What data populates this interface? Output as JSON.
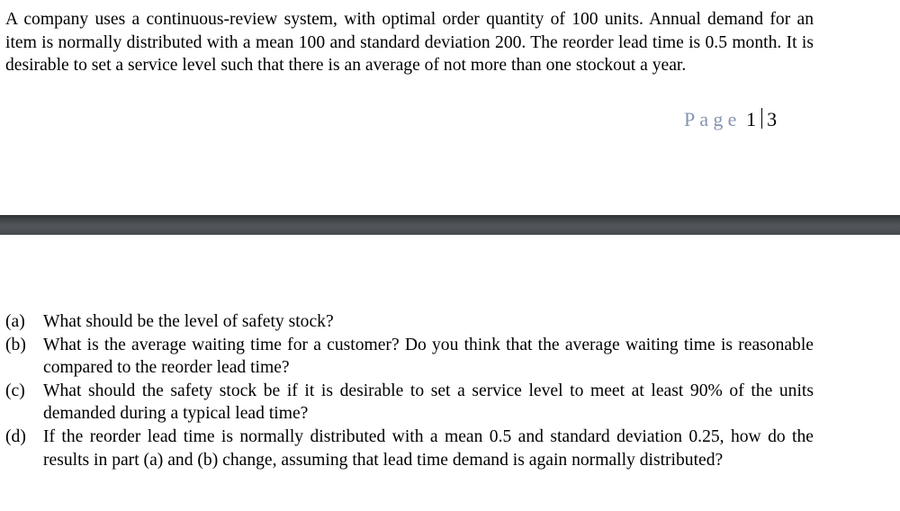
{
  "document": {
    "intro_paragraph": "A company uses a continuous-review system, with optimal order quantity of 100 units. Annual demand for an item is normally distributed with a mean 100 and standard deviation 200. The reorder lead time is 0.5 month. It is desirable to set a service level such that there is an average of not more than one stockout a year.",
    "page_footer": {
      "word": "Page",
      "current": "1",
      "total": "3"
    },
    "questions": [
      {
        "marker": "(a)",
        "text": "What should be the level of safety stock?"
      },
      {
        "marker": "(b)",
        "text": "What is the average waiting time for a customer? Do you think that the average waiting time is reasonable compared to the reorder lead time?"
      },
      {
        "marker": "(c)",
        "text": "What should the safety stock be if it is desirable to set a service level to meet at least 90% of the units demanded during a typical lead time?"
      },
      {
        "marker": "(d)",
        "text": "If the reorder lead time is normally distributed with a mean 0.5 and standard deviation 0.25, how do the results in part (a) and (b) change, assuming that lead time demand is again normally distributed?"
      }
    ]
  },
  "colors": {
    "page_word": "#8496b0",
    "text": "#000000",
    "divider": "#4a4e52"
  }
}
